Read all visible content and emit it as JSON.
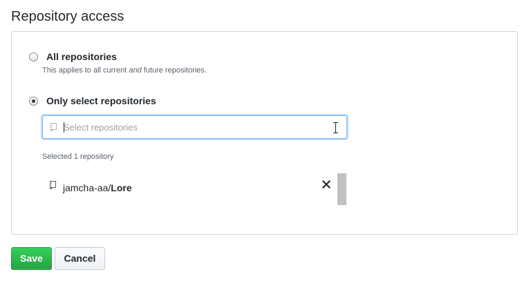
{
  "section": {
    "title": "Repository access"
  },
  "options": {
    "all": {
      "label": "All repositories",
      "note_before": "This applies to all current ",
      "note_em": "and",
      "note_after": " future repositories.",
      "selected": false
    },
    "select": {
      "label": "Only select repositories",
      "selected": true
    }
  },
  "search": {
    "placeholder": "Select repositories",
    "value": ""
  },
  "selection": {
    "count_text": "Selected 1 repository",
    "repos": [
      {
        "owner": "jamcha-aa/",
        "name": "Lore"
      }
    ]
  },
  "actions": {
    "save_label": "Save",
    "cancel_label": "Cancel"
  },
  "colors": {
    "save_green": "#28a745",
    "focus_blue": "#79b8ff",
    "border": "#d1d5da"
  },
  "icons": [
    "repo-icon",
    "close-icon",
    "text-cursor-icon"
  ]
}
